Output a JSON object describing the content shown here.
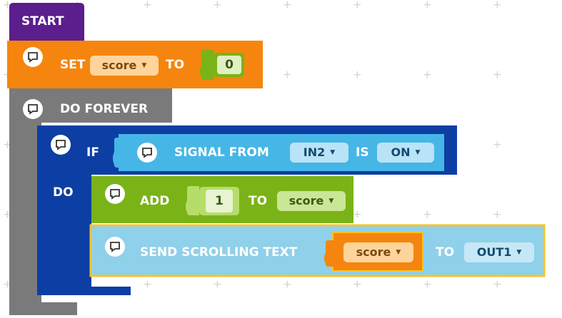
{
  "colors": {
    "event": "#5b1e8c",
    "set_variable": "#f5850e",
    "loop": "#7a7a7a",
    "control": "#0d3ea3",
    "sensor": "#46b6e6",
    "math": "#7ab317",
    "display": "#8fd0ea",
    "highlight": "#f7c32a"
  },
  "workspace": {
    "start": {
      "label": "START"
    },
    "set_block": {
      "label_set": "SET",
      "variable": "score",
      "label_to": "TO",
      "value": "0",
      "comment_icon": "comment-icon"
    },
    "forever_block": {
      "label": "DO FOREVER",
      "comment_icon": "comment-icon"
    },
    "if_block": {
      "label_if": "IF",
      "label_do": "DO",
      "comment_icon": "comment-icon",
      "condition": {
        "label_signal": "SIGNAL FROM",
        "port": "IN2",
        "label_is": "IS",
        "state": "ON",
        "comment_icon": "comment-icon"
      }
    },
    "add_block": {
      "label_add": "ADD",
      "value": "1",
      "label_to": "TO",
      "variable": "score",
      "comment_icon": "comment-icon"
    },
    "scroll_block": {
      "label": "SEND SCROLLING TEXT",
      "variable": "score",
      "label_to": "TO",
      "output": "OUT1",
      "comment_icon": "comment-icon",
      "selected": true
    }
  }
}
